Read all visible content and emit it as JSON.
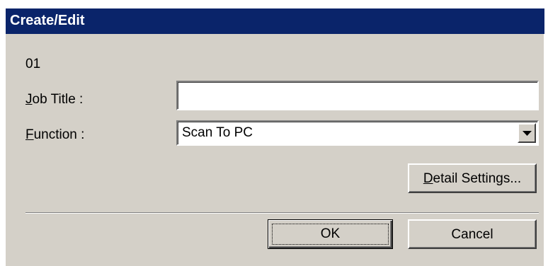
{
  "dialog": {
    "title": "Create/Edit",
    "job_number": "01"
  },
  "form": {
    "job_title": {
      "label_accel": "J",
      "label_rest": "ob Title :",
      "value": ""
    },
    "function": {
      "label_accel": "F",
      "label_rest": "unction :",
      "selected": "Scan To PC"
    }
  },
  "buttons": {
    "detail_settings": {
      "accel": "D",
      "rest": "etail Settings..."
    },
    "ok": "OK",
    "cancel": "Cancel"
  },
  "icons": {
    "dropdown": "triangle-down-icon"
  },
  "colors": {
    "titlebar": "#0a246a",
    "title_text": "#ffffff",
    "dialog_face": "#d4d0c8",
    "field_bg": "#ffffff"
  }
}
